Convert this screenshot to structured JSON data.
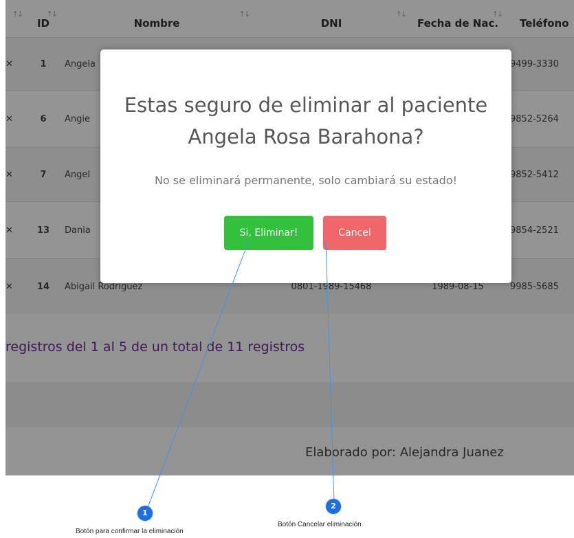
{
  "table": {
    "headers": {
      "id": "ID",
      "nombre": "Nombre",
      "dni": "DNI",
      "fecha": "Fecha de Nac.",
      "telefono": "Teléfono"
    },
    "rows": [
      {
        "id": "1",
        "nombre": "Angela",
        "dni": "",
        "fecha": "",
        "telefono": "9499-3330"
      },
      {
        "id": "6",
        "nombre": "Angie",
        "dni": "",
        "fecha": "",
        "telefono": "9852-5264"
      },
      {
        "id": "7",
        "nombre": "Angel",
        "dni": "",
        "fecha": "",
        "telefono": "9852-5412"
      },
      {
        "id": "13",
        "nombre": "Dania",
        "dni": "",
        "fecha": "",
        "telefono": "9854-2521"
      },
      {
        "id": "14",
        "nombre": "Abigail Rodriguez",
        "dni": "0801-1989-15468",
        "fecha": "1989-08-15",
        "telefono": "9985-5685"
      }
    ]
  },
  "pagination": {
    "info": "registros del 1 al 5 de un total de 11 registros"
  },
  "footer": {
    "credit": "Elaborado por: Alejandra Juanez"
  },
  "modal": {
    "title": "Estas seguro de eliminar al paciente Angela Rosa Barahona?",
    "text": "No se eliminará permanente, solo cambiará su estado!",
    "confirm_label": "Si, Eliminar!",
    "cancel_label": "Cancel"
  },
  "annotations": [
    {
      "number": "1",
      "label": "Botón para confirmar la eliminación"
    },
    {
      "number": "2",
      "label": "Botón Cancelar eliminación"
    }
  ],
  "colors": {
    "confirm": "#33c13d",
    "cancel": "#f0676b",
    "callout": "#1f6fe0",
    "info_text": "#6a2f93"
  }
}
